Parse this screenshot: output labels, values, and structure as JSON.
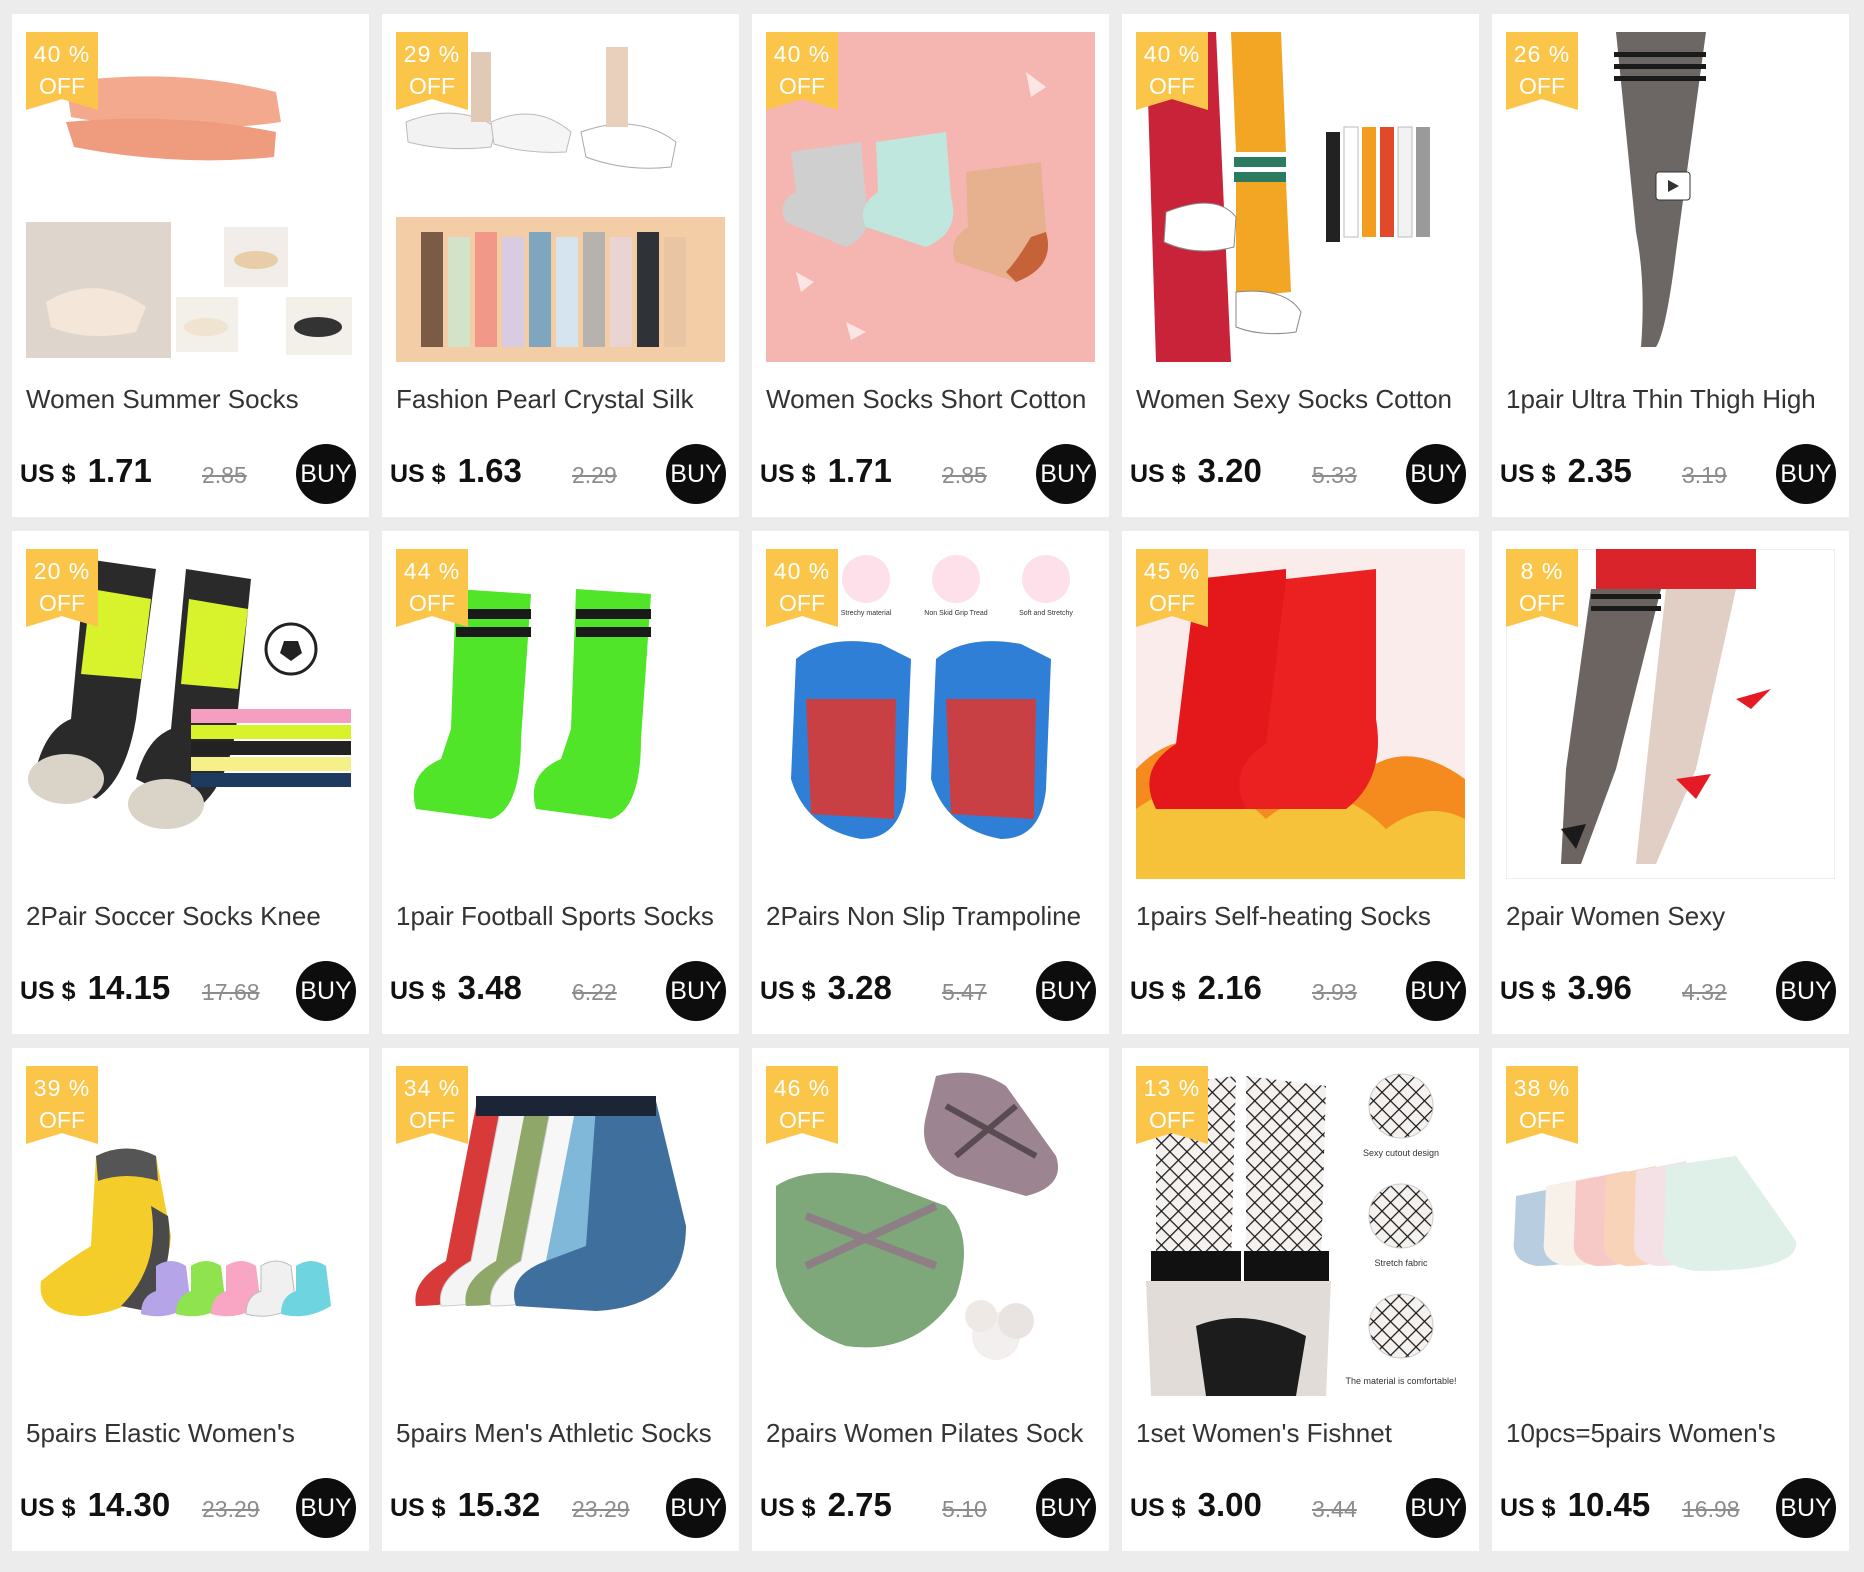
{
  "currency": "US $",
  "off_label": "OFF",
  "buy_label": "BUY",
  "products": [
    {
      "title": "Women Summer Socks",
      "discount": "40 %",
      "price": "1.71",
      "old_price": "2.85",
      "bg": "#f3ebe2"
    },
    {
      "title": "Fashion Pearl Crystal Silk",
      "discount": "29 %",
      "price": "1.63",
      "old_price": "2.29",
      "bg": "#f5ede6"
    },
    {
      "title": "Women Socks Short Cotton",
      "discount": "40 %",
      "price": "1.71",
      "old_price": "2.85",
      "bg": "#f5b6b1"
    },
    {
      "title": "Women Sexy Socks Cotton",
      "discount": "40 %",
      "price": "3.20",
      "old_price": "5.33",
      "bg": "#ffffff"
    },
    {
      "title": "1pair Ultra Thin Thigh High",
      "discount": "26 %",
      "price": "2.35",
      "old_price": "3.19",
      "bg": "#ffffff"
    },
    {
      "title": "2Pair Soccer Socks Knee",
      "discount": "20 %",
      "price": "14.15",
      "old_price": "17.68",
      "bg": "#ffffff"
    },
    {
      "title": "1pair Football Sports Socks",
      "discount": "44 %",
      "price": "3.48",
      "old_price": "6.22",
      "bg": "#ffffff"
    },
    {
      "title": "2Pairs Non Slip Trampoline",
      "discount": "40 %",
      "price": "3.28",
      "old_price": "5.47",
      "bg": "#ffffff"
    },
    {
      "title": "1pairs Self-heating Socks",
      "discount": "45 %",
      "price": "2.16",
      "old_price": "3.93",
      "bg": "#fbecec"
    },
    {
      "title": "2pair Women Sexy",
      "discount": "8 %",
      "price": "3.96",
      "old_price": "4.32",
      "bg": "#ffffff"
    },
    {
      "title": "5pairs Elastic Women's",
      "discount": "39 %",
      "price": "14.30",
      "old_price": "23.29",
      "bg": "#ffffff"
    },
    {
      "title": "5pairs Men's Athletic Socks",
      "discount": "34 %",
      "price": "15.32",
      "old_price": "23.29",
      "bg": "#ffffff"
    },
    {
      "title": "2pairs Women Pilates Sock",
      "discount": "46 %",
      "price": "2.75",
      "old_price": "5.10",
      "bg": "#ffffff"
    },
    {
      "title": "1set Women's Fishnet",
      "discount": "13 %",
      "price": "3.00",
      "old_price": "3.44",
      "bg": "#ffffff"
    },
    {
      "title": "10pcs=5pairs Women's",
      "discount": "38 %",
      "price": "10.45",
      "old_price": "16.98",
      "bg": "#ffffff"
    }
  ],
  "image_captions": {
    "p8": [
      "Strechy material",
      "Non Skid Grip Tread",
      "Soft and Stretchy"
    ],
    "p14": [
      "Sexy cutout design",
      "Stretch fabric",
      "The material is comfortable!"
    ]
  },
  "colors": {
    "badge": "#fbc54a",
    "buy_button": "#0d0d0d",
    "page_bg": "#ececec"
  }
}
